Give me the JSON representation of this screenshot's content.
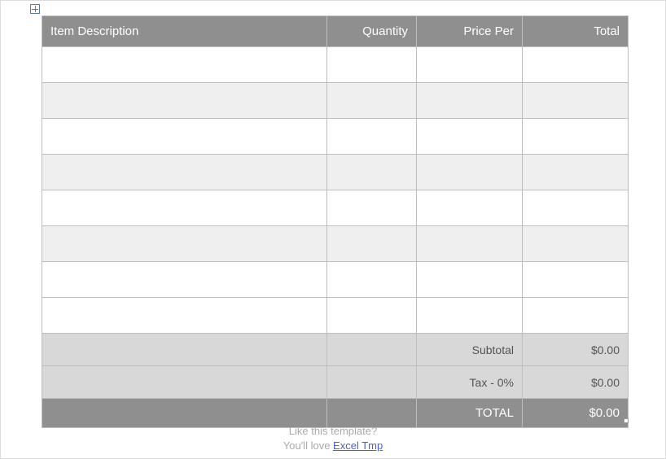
{
  "headers": {
    "desc": "Item Description",
    "qty": "Quantity",
    "price": "Price Per",
    "total": "Total"
  },
  "rows": [
    {
      "desc": "",
      "qty": "",
      "price": "",
      "total": ""
    },
    {
      "desc": "",
      "qty": "",
      "price": "",
      "total": ""
    },
    {
      "desc": "",
      "qty": "",
      "price": "",
      "total": ""
    },
    {
      "desc": "",
      "qty": "",
      "price": "",
      "total": ""
    },
    {
      "desc": "",
      "qty": "",
      "price": "",
      "total": ""
    },
    {
      "desc": "",
      "qty": "",
      "price": "",
      "total": ""
    },
    {
      "desc": "",
      "qty": "",
      "price": "",
      "total": ""
    },
    {
      "desc": "",
      "qty": "",
      "price": "",
      "total": ""
    }
  ],
  "summary": {
    "subtotal_label": "Subtotal",
    "subtotal_value": "$0.00",
    "tax_label": "Tax - 0%",
    "tax_value": "$0.00",
    "total_label": "TOTAL",
    "total_value": "$0.00"
  },
  "footer": {
    "line1": "Like this template?",
    "line2_prefix": "You'll love ",
    "link_text": "Excel Tmp"
  }
}
